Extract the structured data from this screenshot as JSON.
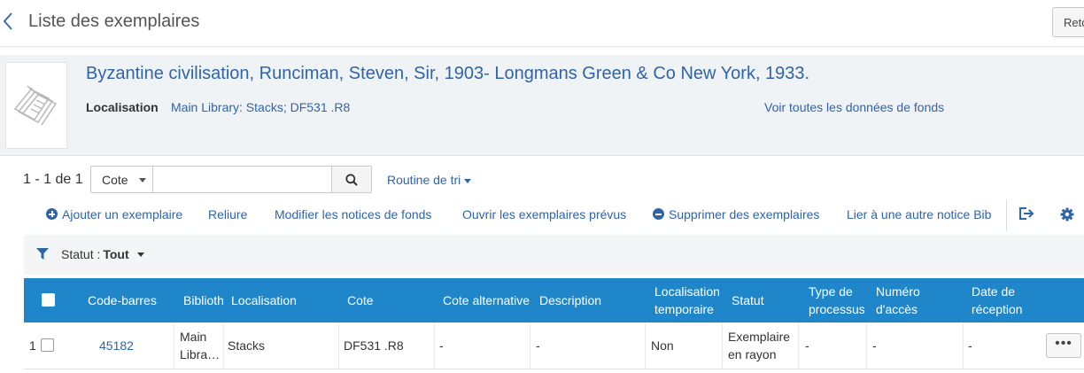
{
  "header": {
    "title": "Liste des exemplaires",
    "right_button": "Retour"
  },
  "record": {
    "title": "Byzantine civilisation, Runciman, Steven, Sir, 1903- Longmans Green & Co New York, 1933.",
    "location_label": "Localisation",
    "location_value": "Main Library: Stacks; DF531 .R8",
    "all_holdings_link": "Voir toutes les données de fonds"
  },
  "results": {
    "count": "1 - 1 de 1",
    "search_type": "Cote",
    "search_placeholder": "",
    "sort_label": "Routine de tri"
  },
  "toolbar": {
    "add_item": "Ajouter un exemplaire",
    "binding": "Reliure",
    "edit_holdings": "Modifier les notices de fonds",
    "open_predicted": "Ouvrir les exemplaires prévus",
    "delete_items": "Supprimer des exemplaires",
    "relink": "Lier à une autre notice Bib"
  },
  "filter": {
    "label": "Statut :",
    "value": "Tout"
  },
  "table": {
    "headers": {
      "barcode": "Code-barres",
      "library": "Biblioth",
      "location": "Localisation",
      "call_number": "Cote",
      "alt_call_number": "Cote alternative",
      "description": "Description",
      "temp_location_1": "Localisation",
      "temp_location_2": "temporaire",
      "status": "Statut",
      "process_type_1": "Type de",
      "process_type_2": "processus",
      "accession_1": "Numéro",
      "accession_2": "d'accès",
      "receiving_1": "Date de",
      "receiving_2": "réception"
    },
    "rows": [
      {
        "num": "1",
        "barcode": "45182",
        "library_1": "Main",
        "library_2": "Libra…",
        "location": "Stacks",
        "call_number": "DF531 .R8",
        "alt_call_number": "-",
        "description": "-",
        "temp_location": "Non",
        "status_1": "Exemplaire",
        "status_2": "en rayon",
        "process_type": "-",
        "accession": "-",
        "receiving": "-",
        "actions": "•••"
      }
    ]
  }
}
